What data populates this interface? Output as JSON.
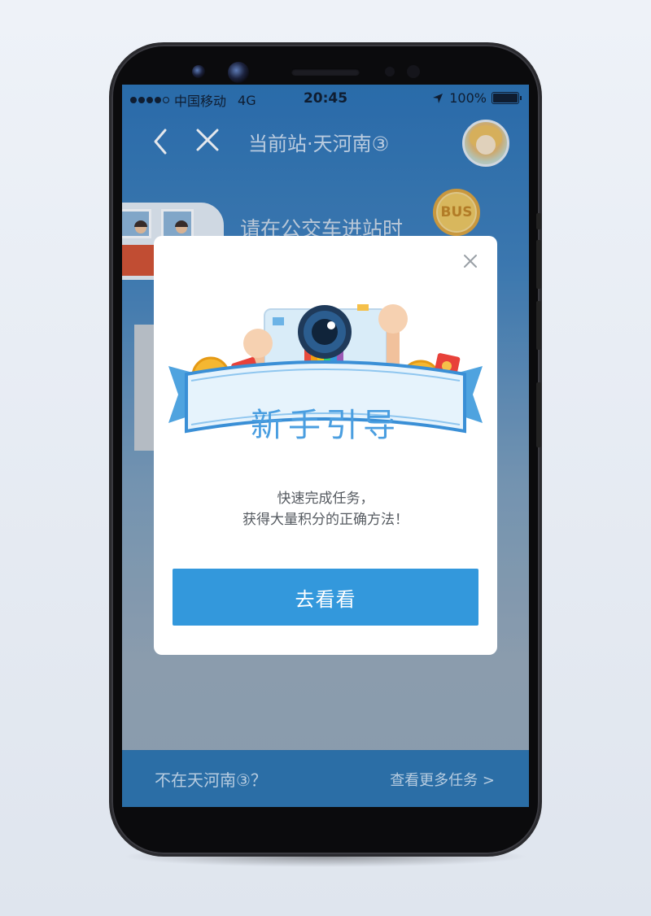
{
  "status_bar": {
    "carrier": "中国移动",
    "network": "4G",
    "time": "20:45",
    "battery": "100%"
  },
  "navbar": {
    "title": "当前站·天河南③",
    "back_icon": "chevron-left-icon",
    "close_icon": "close-icon"
  },
  "background": {
    "hint_text": "请在公交车进站时",
    "bus_badge": "BUS"
  },
  "modal": {
    "banner_text": "新手引导",
    "subtitle_line1": "快速完成任务，",
    "subtitle_line2": "获得大量积分的正确方法！",
    "cta_label": "去看看",
    "close_icon": "close-icon"
  },
  "bottom_bar": {
    "left_text": "不在天河南③？",
    "right_text": "查看更多任务 >"
  },
  "colors": {
    "primary": "#3398dc",
    "navbar_bg": "#2b72b3",
    "bottom_bar_bg": "#2b6ea6"
  }
}
